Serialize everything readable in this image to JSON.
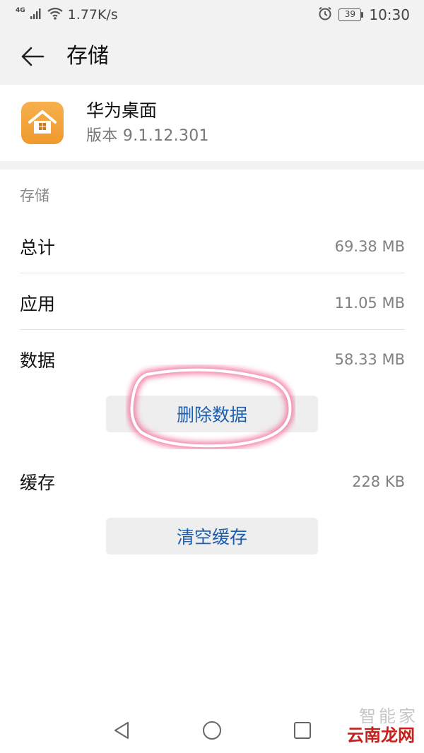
{
  "status_bar": {
    "network_type": "4G",
    "net_speed": "1.77K/s",
    "battery_level": "39",
    "time": "10:30"
  },
  "app_bar": {
    "title": "存储"
  },
  "app_info": {
    "name": "华为桌面",
    "version": "版本 9.1.12.301"
  },
  "storage": {
    "section_label": "存储",
    "rows": [
      {
        "label": "总计",
        "value": "69.38 MB"
      },
      {
        "label": "应用",
        "value": "11.05 MB"
      },
      {
        "label": "数据",
        "value": "58.33 MB"
      }
    ],
    "delete_data_label": "删除数据",
    "cache": {
      "label": "缓存",
      "value": "228 KB"
    },
    "clear_cache_label": "清空缓存"
  },
  "watermark": {
    "top_text": "智能家",
    "bottom_text": "云南龙网"
  },
  "colors": {
    "accent": "#1d5fae",
    "highlight": "#e8547f",
    "app_icon": "#f2a23a"
  }
}
